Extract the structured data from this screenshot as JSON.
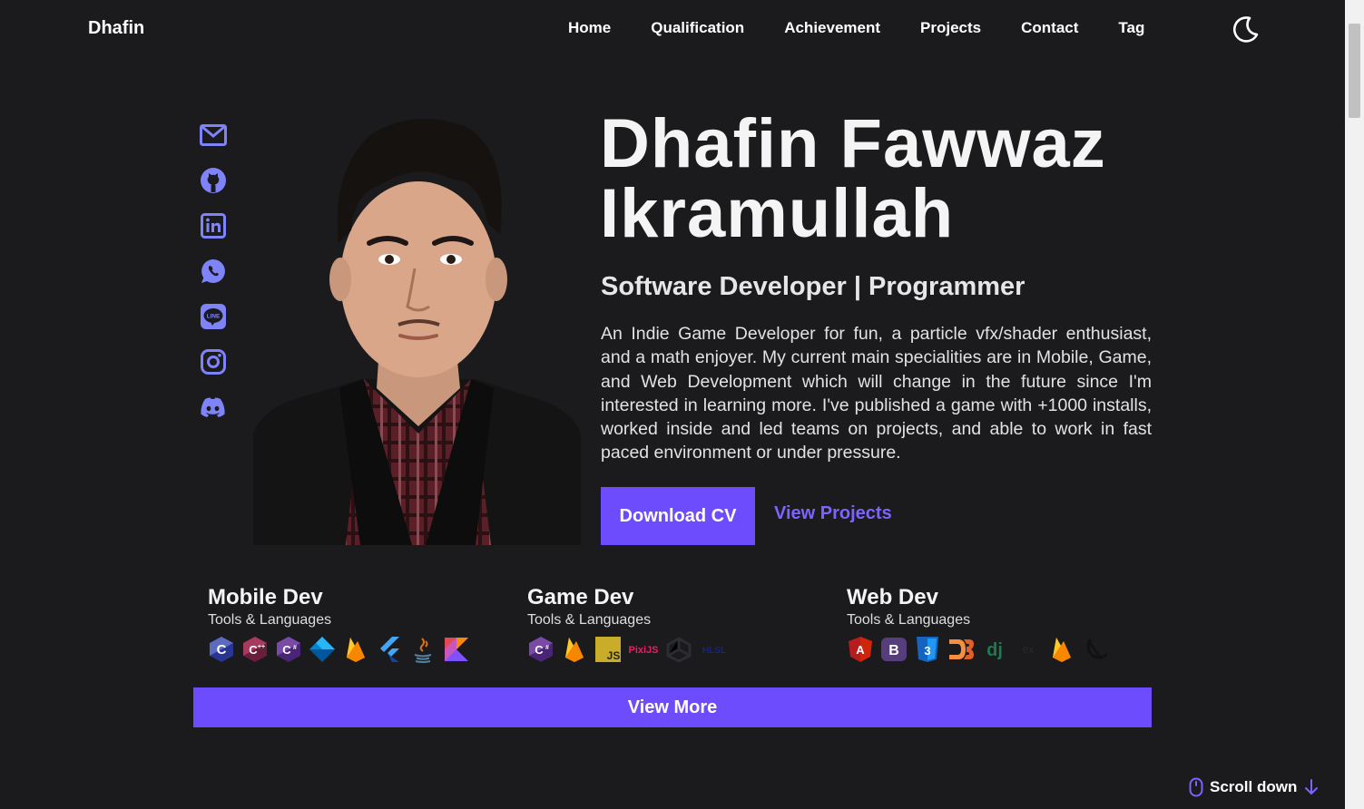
{
  "header": {
    "brand": "Dhafin",
    "nav": [
      "Home",
      "Qualification",
      "Achievement",
      "Projects",
      "Contact",
      "Tag"
    ],
    "theme_icon": "moon-icon"
  },
  "socials": [
    "mail-icon",
    "github-icon",
    "linkedin-icon",
    "whatsapp-icon",
    "line-icon",
    "instagram-icon",
    "discord-icon"
  ],
  "hero": {
    "name_line1": "Dhafin Fawwaz",
    "name_line2": "Ikramullah",
    "subtitle": "Software Developer | Programmer",
    "description": "An Indie Game Developer for fun, a particle vfx/shader enthusiast, and a math enjoyer. My current main specialities are in Mobile, Game, and Web Development which will change in the future since I'm interested in learning more. I've published a game with +1000 installs, worked inside and led teams on projects, and able to work in fast paced environment or under pressure.",
    "download_cv": "Download CV",
    "view_projects": "View Projects",
    "line_icon_text": "LINE"
  },
  "skills": [
    {
      "title": "Mobile Dev",
      "subtitle": "Tools & Languages",
      "icons": [
        "c-icon",
        "cpp-icon",
        "csharp-icon",
        "dart-icon",
        "firebase-icon",
        "flutter-icon",
        "java-icon",
        "kotlin-icon"
      ]
    },
    {
      "title": "Game Dev",
      "subtitle": "Tools & Languages",
      "icons": [
        "csharp-icon",
        "firebase-icon",
        "javascript-icon",
        "pixijs-icon",
        "unity-icon",
        "hlsl-icon"
      ],
      "icon_text": {
        "javascript": "JS",
        "pixijs": "PixiJS",
        "hlsl": "HLSL"
      }
    },
    {
      "title": "Web Dev",
      "subtitle": "Tools & Languages",
      "icons": [
        "angular-icon",
        "bootstrap-icon",
        "css3-icon",
        "d3-icon",
        "django-icon",
        "express-icon",
        "firebase-icon",
        "nextjs-icon"
      ],
      "icon_text": {
        "angular": "A",
        "bootstrap": "B",
        "css3": "3",
        "django": "dj",
        "express": "ex"
      }
    }
  ],
  "view_more": "View More",
  "scroll_down": "Scroll down",
  "colors": {
    "background": "#1b1a1d",
    "accent": "#6d4cfe",
    "link": "#7b64ff",
    "social_icons": "#7e84f7"
  }
}
